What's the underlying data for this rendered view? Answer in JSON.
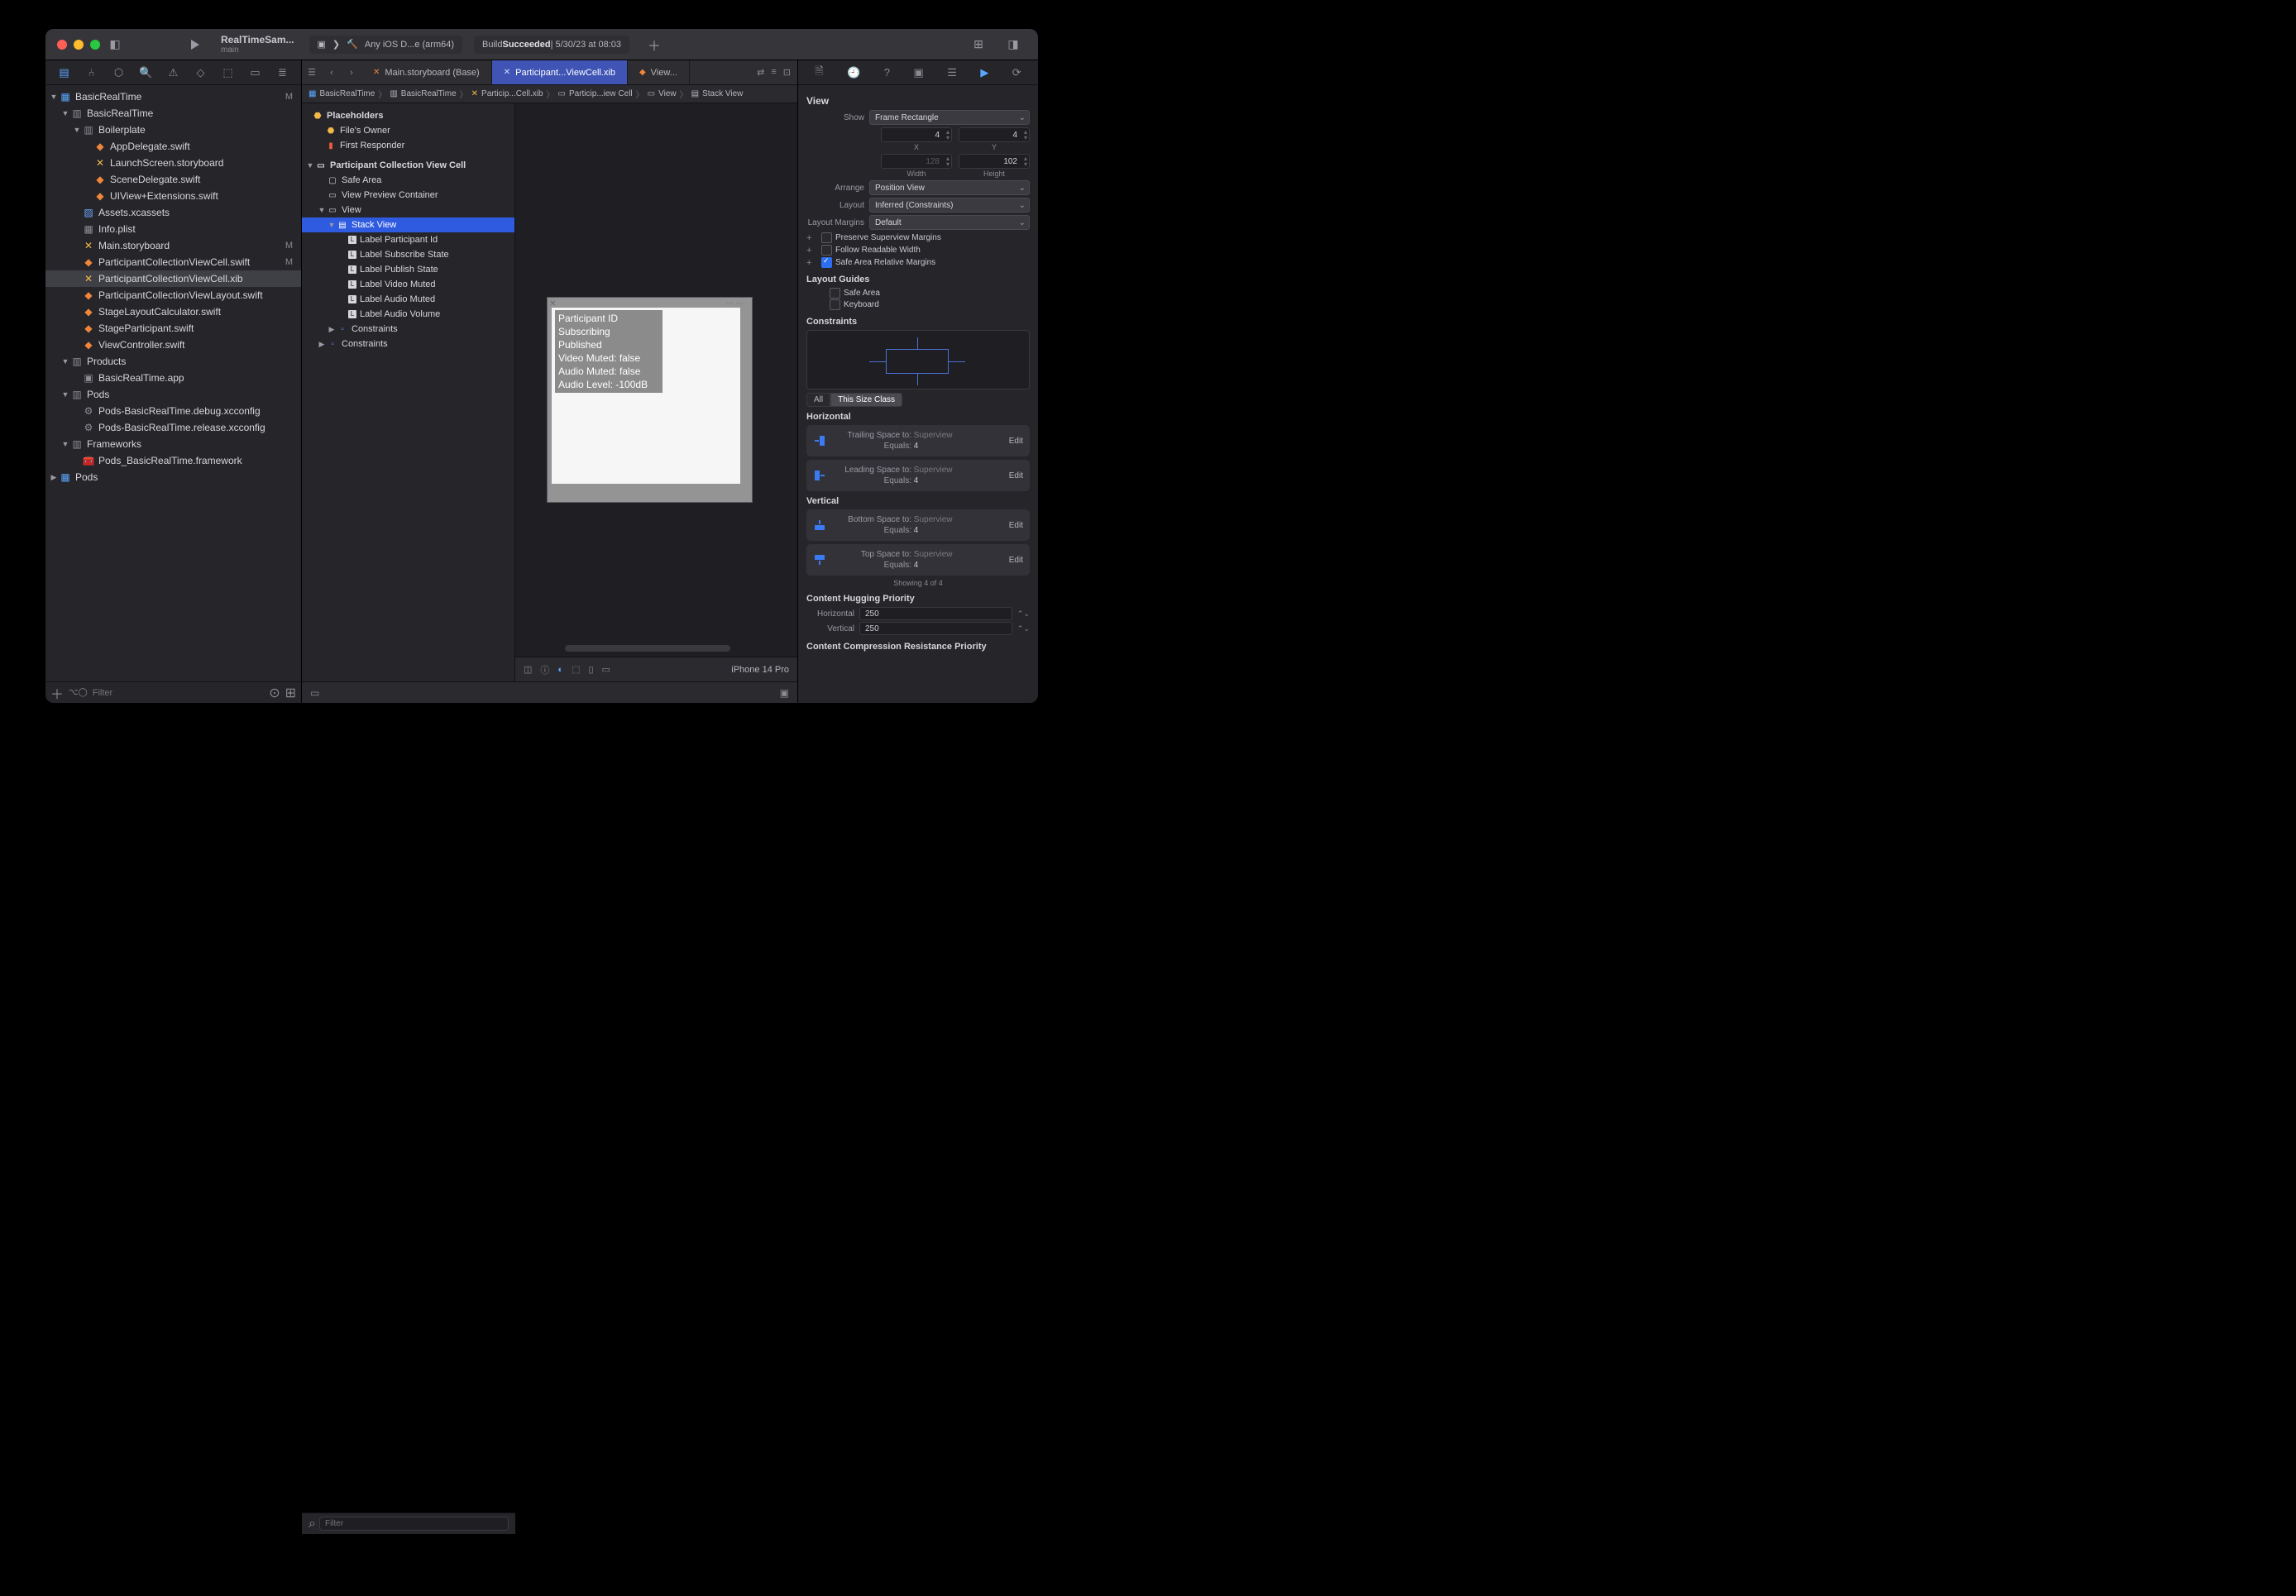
{
  "titlebar": {
    "scheme_name": "RealTimeSam...",
    "scheme_branch": "main",
    "destination": "Any iOS D...e (arm64)",
    "status_prefix": "Build ",
    "status_word": "Succeeded",
    "status_suffix": " | 5/30/23 at 08:03"
  },
  "navigator": {
    "root": "BasicRealTime",
    "root_m": "M",
    "group1": "BasicRealTime",
    "boilerplate": "Boilerplate",
    "files_boiler": [
      "AppDelegate.swift",
      "LaunchScreen.storyboard",
      "SceneDelegate.swift",
      "UIView+Extensions.swift"
    ],
    "assets": "Assets.xcassets",
    "info": "Info.plist",
    "main_sb": "Main.storyboard",
    "main_sb_m": "M",
    "pcvc_swift": "ParticipantCollectionViewCell.swift",
    "pcvc_swift_m": "M",
    "pcvc_xib": "ParticipantCollectionViewCell.xib",
    "pcv_layout": "ParticipantCollectionViewLayout.swift",
    "stage_calc": "StageLayoutCalculator.swift",
    "stage_part": "StageParticipant.swift",
    "vc": "ViewController.swift",
    "products": "Products",
    "app": "BasicRealTime.app",
    "pods": "Pods",
    "pods_debug": "Pods-BasicRealTime.debug.xcconfig",
    "pods_release": "Pods-BasicRealTime.release.xcconfig",
    "frameworks": "Frameworks",
    "pods_fw": "Pods_BasicRealTime.framework",
    "pods_proj": "Pods",
    "filter_ph": "Filter"
  },
  "tabs": {
    "t0": "Main.storyboard (Base)",
    "t1": "Participant...ViewCell.xib",
    "t2": "View..."
  },
  "crumbs": {
    "c0": "BasicRealTime",
    "c1": "BasicRealTime",
    "c2": "Particip...Cell.xib",
    "c3": "Particip...iew Cell",
    "c4": "View",
    "c5": "Stack View"
  },
  "outline": {
    "placeholders": "Placeholders",
    "files_owner": "File's Owner",
    "first_resp": "First Responder",
    "cell": "Participant Collection View Cell",
    "safe_area": "Safe Area",
    "preview": "View Preview Container",
    "view": "View",
    "stack": "Stack View",
    "labels": [
      "Label Participant Id",
      "Label Subscribe State",
      "Label Publish State",
      "Label Video Muted",
      "Label Audio Muted",
      "Label Audio Volume"
    ],
    "constraints1": "Constraints",
    "constraints2": "Constraints",
    "filter_ph": "Filter"
  },
  "canvas": {
    "overlay": [
      "Participant ID",
      "Subscribing",
      "Published",
      "Video Muted: false",
      "Audio Muted: false",
      "Audio Level: -100dB"
    ],
    "device": "iPhone 14 Pro"
  },
  "inspector": {
    "view_hdr": "View",
    "show_label": "Show",
    "show_value": "Frame Rectangle",
    "x": "4",
    "y": "4",
    "x_lbl": "X",
    "y_lbl": "Y",
    "w": "128",
    "h": "102",
    "w_lbl": "Width",
    "h_lbl": "Height",
    "arrange_label": "Arrange",
    "arrange_value": "Position View",
    "layout_label": "Layout",
    "layout_value": "Inferred (Constraints)",
    "margins_label": "Layout Margins",
    "margins_value": "Default",
    "m0": "Preserve Superview Margins",
    "m1": "Follow Readable Width",
    "m2": "Safe Area Relative Margins",
    "guides_hdr": "Layout Guides",
    "g0": "Safe Area",
    "g1": "Keyboard",
    "constraints_hdr": "Constraints",
    "seg_all": "All",
    "seg_this": "This Size Class",
    "horiz_hdr": "Horizontal",
    "vert_hdr": "Vertical",
    "edit": "Edit",
    "c_trail_k": "Trailing Space to:",
    "c_trail_v": "Superview",
    "c_lead_k": "Leading Space to:",
    "c_lead_v": "Superview",
    "c_bot_k": "Bottom Space to:",
    "c_bot_v": "Superview",
    "c_top_k": "Top Space to:",
    "c_top_v": "Superview",
    "equals_k": "Equals:",
    "equals_v": "4",
    "showing": "Showing 4 of 4",
    "hug_hdr": "Content Hugging Priority",
    "hug_h_lbl": "Horizontal",
    "hug_h": "250",
    "hug_v_lbl": "Vertical",
    "hug_v": "250",
    "ccr_hdr": "Content Compression Resistance Priority"
  }
}
